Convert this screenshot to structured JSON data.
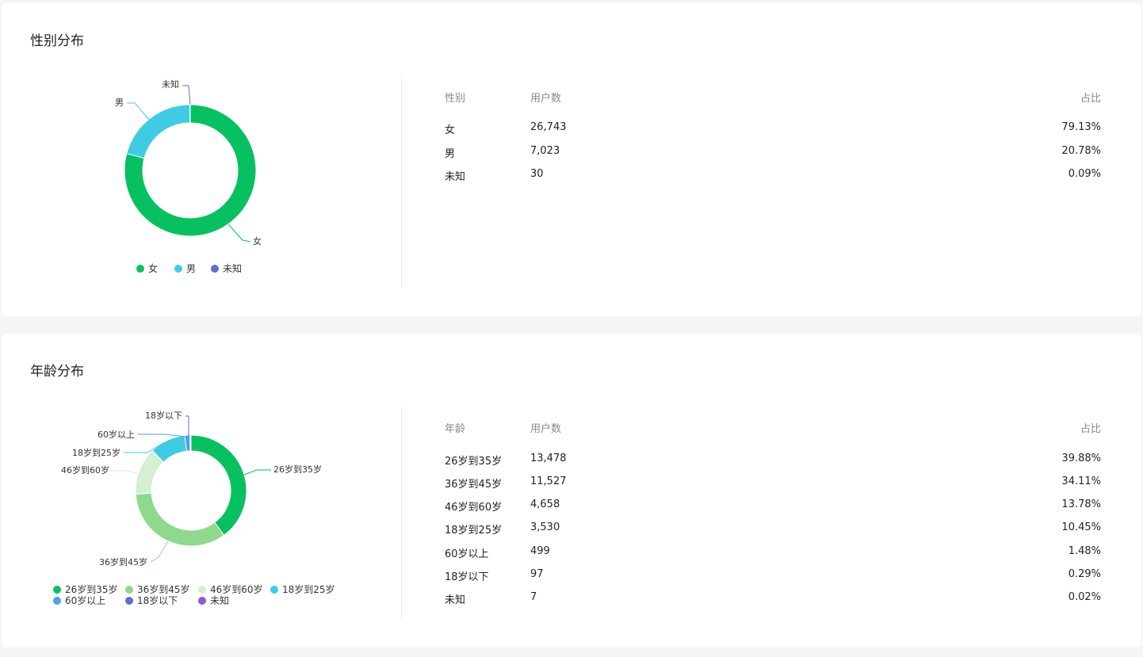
{
  "gender": {
    "title": "性别分布",
    "table": {
      "headers": [
        "性别",
        "用户数",
        "占比"
      ],
      "rows": [
        [
          "女",
          "26,743",
          "79.13%"
        ],
        [
          "男",
          "7,023",
          "20.78%"
        ],
        [
          "未知",
          "30",
          "0.09%"
        ]
      ]
    },
    "chart_data": {
      "type": "pie",
      "categories": [
        "女",
        "男",
        "未知"
      ],
      "values": [
        26743,
        7023,
        30
      ],
      "colors": [
        "#07c160",
        "#3fcbe4",
        "#5e6fd0"
      ]
    },
    "legend": [
      "女",
      "男",
      "未知"
    ]
  },
  "age": {
    "title": "年龄分布",
    "table": {
      "headers": [
        "年龄",
        "用户数",
        "占比"
      ],
      "rows": [
        [
          "26岁到35岁",
          "13,478",
          "39.88%"
        ],
        [
          "36岁到45岁",
          "11,527",
          "34.11%"
        ],
        [
          "46岁到60岁",
          "4,658",
          "13.78%"
        ],
        [
          "18岁到25岁",
          "3,530",
          "10.45%"
        ],
        [
          "60岁以上",
          "499",
          "1.48%"
        ],
        [
          "18岁以下",
          "97",
          "0.29%"
        ],
        [
          "未知",
          "7",
          "0.02%"
        ]
      ]
    },
    "chart_data": {
      "type": "pie",
      "categories": [
        "26岁到35岁",
        "36岁到45岁",
        "46岁到60岁",
        "18岁到25岁",
        "60岁以上",
        "18岁以下",
        "未知"
      ],
      "values": [
        13478,
        11527,
        4658,
        3530,
        499,
        97,
        7
      ],
      "colors": [
        "#07c160",
        "#8ed98c",
        "#d4efd3",
        "#3fcbe4",
        "#4aa3ea",
        "#5e6fd0",
        "#8e56d8"
      ]
    },
    "legend": [
      "26岁到35岁",
      "36岁到45岁",
      "46岁到60岁",
      "18岁到25岁",
      "60岁以上",
      "18岁以下",
      "未知"
    ]
  }
}
